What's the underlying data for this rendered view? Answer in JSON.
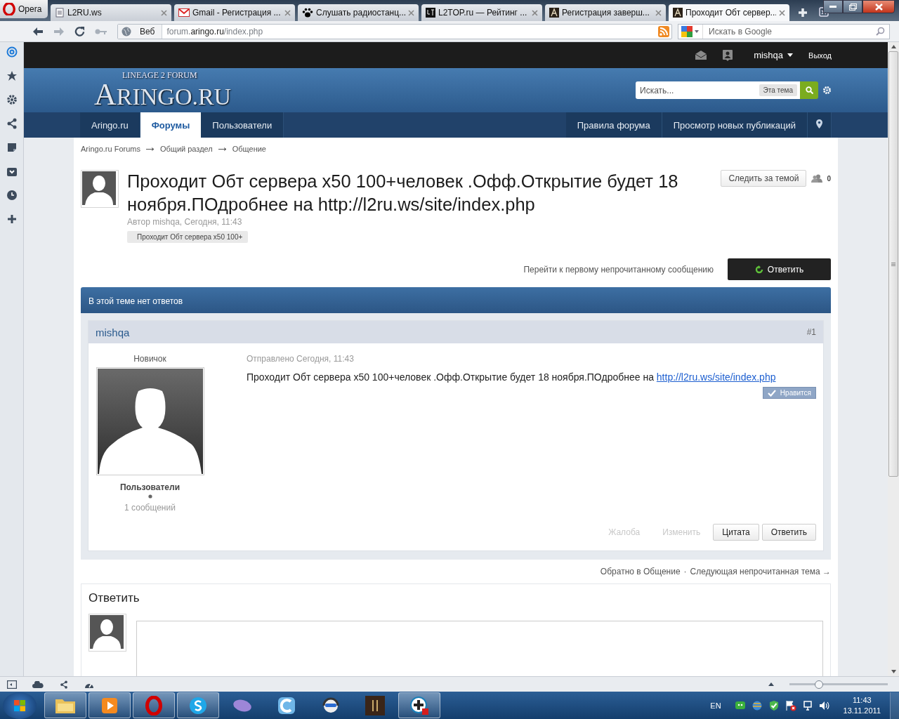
{
  "browser": {
    "menu_button": "Opera",
    "tabs": [
      {
        "title": "L2RU.ws",
        "kind": "page",
        "selected": false
      },
      {
        "title": "Gmail - Регистрация ...",
        "kind": "mail",
        "selected": false
      },
      {
        "title": "Слушать радиостанц...",
        "kind": "paw",
        "selected": false
      },
      {
        "title": "L2TOP.ru — Рейтинг ...",
        "kind": "dark",
        "selected": false
      },
      {
        "title": "Регистрация заверш...",
        "kind": "letter",
        "selected": false
      },
      {
        "title": "Проходит Обт сервер...",
        "kind": "letter",
        "selected": true
      }
    ],
    "address": {
      "scope": "Веб",
      "url": "forum.**aringo.ru**/index.php"
    },
    "search": {
      "placeholder": "Искать в Google"
    }
  },
  "forum": {
    "user_bar": {
      "username": "mishqa",
      "logout": "Выход"
    },
    "logo": {
      "tagline": "LINEAGE 2 FORUM",
      "name": "ARINGO.RU"
    },
    "search": {
      "placeholder": "Искать...",
      "scope": "Эта тема"
    },
    "nav": [
      {
        "label": "Aringo.ru",
        "selected": false
      },
      {
        "label": "Форумы",
        "selected": true
      },
      {
        "label": "Пользователи",
        "selected": false
      }
    ],
    "nav_right": [
      "Правила форума",
      "Просмотр новых публикаций"
    ],
    "breadcrumbs": [
      "Aringo.ru Forums",
      "Общий раздел",
      "Общение"
    ],
    "topic": {
      "title": "Проходит Обт сервера x50 100+человек .Офф.Открытие будет 18 ноября.ПОдробнее на http://l2ru.ws/site/index.php",
      "meta": "Автор mishqa, Сегодня, 11:43",
      "tag": "Проходит Обт сервера x50 100+",
      "follow": "Следить за темой",
      "followers": "0"
    },
    "unread_link": "Перейти к первому непрочитанному сообщению",
    "reply_button": "Ответить",
    "banner": "В этой теме нет ответов",
    "post": {
      "author": "mishqa",
      "number": "#1",
      "rank": "Новичок",
      "group": "Пользователи",
      "count": "1 сообщений",
      "posted": "Отправлено Сегодня, 11:43",
      "text": "Проходит Обт сервера x50 100+человек .Офф.Открытие будет 18 ноября.ПОдробнее на",
      "link": "http://l2ru.ws/site/index.php",
      "like": "Нравится",
      "actions": [
        {
          "label": "Жалоба",
          "kind": "link"
        },
        {
          "label": "Изменить",
          "kind": "link"
        },
        {
          "label": "Цитата",
          "kind": "button"
        },
        {
          "label": "Ответить",
          "kind": "button"
        }
      ]
    },
    "footer_links": {
      "back": "Обратно в Общение",
      "separator": "·",
      "next": "Следующая непрочитанная тема →"
    },
    "reply_box": {
      "heading": "Ответить"
    }
  },
  "status_bar": {
    "zoom": {
      "level": 0.3
    }
  },
  "taskbar": {
    "apps": [
      {
        "kind": "folder",
        "running": true
      },
      {
        "kind": "media",
        "running": true
      },
      {
        "kind": "opera",
        "running": true
      },
      {
        "kind": "skype",
        "running": true
      },
      {
        "kind": "mouse",
        "running": false
      },
      {
        "kind": "swirl",
        "running": false
      },
      {
        "kind": "headset",
        "running": false
      },
      {
        "kind": "game",
        "running": false
      },
      {
        "kind": "plus",
        "running": true
      }
    ],
    "language": "EN",
    "time": "11:43",
    "date": "13.11.2011"
  }
}
